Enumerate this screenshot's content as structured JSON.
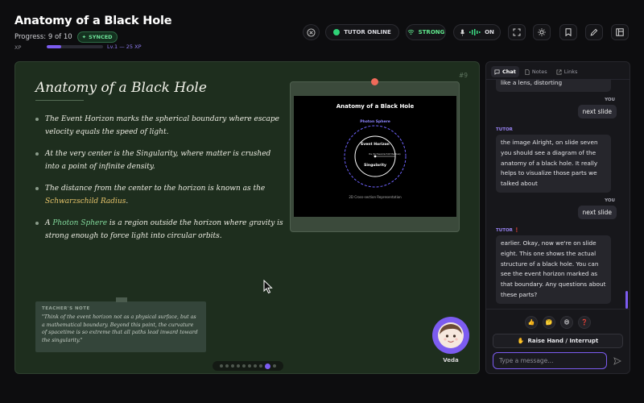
{
  "header": {
    "title": "Anatomy of a Black Hole",
    "progress": "Progress: 9 of 10",
    "synced": "SYNCED",
    "xp_label": "XP",
    "xp_progress": 0.25,
    "level": "Lv.1 — 25 XP",
    "tutor_status": "TUTOR ONLINE",
    "connection": "STRONG",
    "mic_status": "ON"
  },
  "slide": {
    "number": "#9",
    "title": "Anatomy of a Black Hole",
    "bullets": [
      {
        "pre": "The Event Horizon marks the spherical boundary where escape velocity equals the speed of light.",
        "hl": "",
        "post": ""
      },
      {
        "pre": "At the very center is the Singularity, where matter is crushed into a point of infinite density.",
        "hl": "",
        "post": ""
      },
      {
        "pre": "The distance from the center to the horizon is known as the ",
        "hl": "Schwarzschild Radius",
        "post": "."
      },
      {
        "pre": "A ",
        "hl": "Photon Sphere",
        "post": " is a region outside the horizon where gravity is strong enough to force light into circular orbits."
      }
    ],
    "image": {
      "title": "Anatomy of a Black Hole",
      "photon_sphere": "Photon Sphere",
      "event_horizon": "Event Horizon",
      "rs_label": "Rs (Schwarzschild Radius)",
      "singularity": "Singularity",
      "caption": "2D Cross-section Representation"
    },
    "note": {
      "heading": "TEACHER'S NOTE",
      "text": "\"Think of the event horizon not as a physical surface, but as a mathematical boundary. Beyond this point, the curvature of spacetime is so extreme that all paths lead inward toward the singularity.\""
    },
    "dots_total": 10,
    "dots_active": 9
  },
  "avatar": {
    "name": "Veda"
  },
  "chat": {
    "tabs": [
      "Chat",
      "Notes",
      "Links"
    ],
    "messages": [
      {
        "role": "tutor",
        "text": "like a lens, distorting"
      },
      {
        "role": "user",
        "label": "YOU",
        "text": "next slide"
      },
      {
        "role": "tutor",
        "label": "TUTOR",
        "text": "the image Alright, on slide seven you should see a diagram of the anatomy of a black hole. It really helps to visualize those parts we talked about"
      },
      {
        "role": "user",
        "label": "YOU",
        "text": "next slide"
      },
      {
        "role": "tutor",
        "label": "TUTOR",
        "text": "earlier. Okay, now we're on slide eight. This one shows the actual structure of a black hole. You can see the event horizon marked as that boundary. Any questions about these parts?"
      }
    ],
    "reactions": [
      "👍",
      "🤔",
      "😄",
      "❓"
    ],
    "raise_hand": "Raise Hand / Interrupt",
    "input_placeholder": "Type a message..."
  },
  "colors": {
    "accent": "#7c5cf0",
    "online": "#2fd277",
    "slide_bg": "#1e2e1e"
  }
}
